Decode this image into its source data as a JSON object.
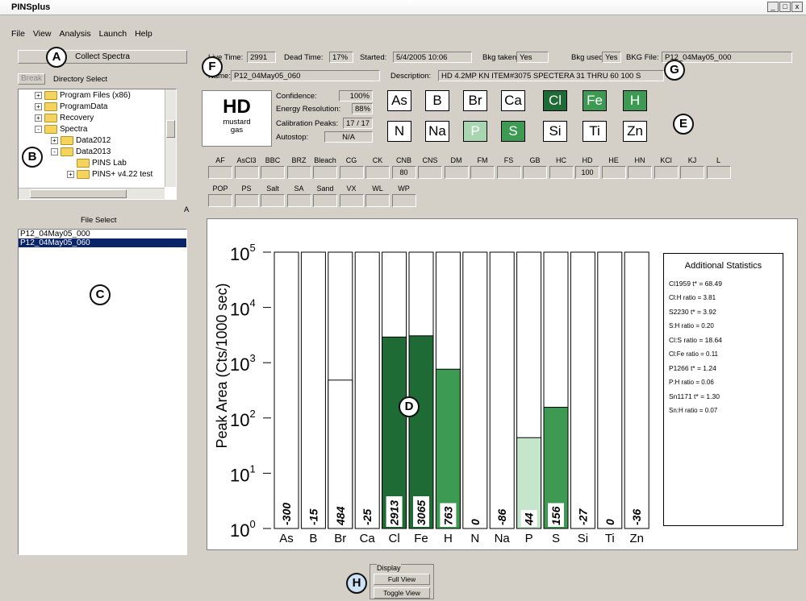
{
  "app": {
    "title": "PINSplus",
    "minimize": "_",
    "maximize": "□",
    "close": "x"
  },
  "menu": [
    "File",
    "View",
    "Analysis",
    "Launch",
    "Help"
  ],
  "left": {
    "collect_spectra": "Collect Spectra",
    "break_button": "Break",
    "directory_select": "Directory Select",
    "tree": [
      {
        "label": "Program Files (x86)",
        "expander": "+"
      },
      {
        "label": "ProgramData",
        "expander": "+"
      },
      {
        "label": "Recovery",
        "expander": "+"
      },
      {
        "label": "Spectra",
        "expander": "-"
      },
      {
        "label": "Data2012",
        "expander": "+"
      },
      {
        "label": "Data2013",
        "expander": "-"
      },
      {
        "label": "PINS Lab",
        "expander": ""
      },
      {
        "label": "PINS+ v4.22 test",
        "expander": "+"
      }
    ],
    "file_select": "File Select",
    "files": [
      "P12_04May05_000",
      "P12_04May05_060"
    ],
    "side_letter": "A"
  },
  "info": {
    "live_time_label": "Live Time:",
    "live_time": "2991",
    "dead_time_label": "Dead Time:",
    "dead_time": "17%",
    "started_label": "Started:",
    "started": "5/4/2005 10:06",
    "bkg_taken_label": "Bkg taken:",
    "bkg_taken": "Yes",
    "bkg_used_label": "Bkg used:",
    "bkg_used": "Yes",
    "bkg_file_label": "BKG File:",
    "bkg_file": "P12_04May05_000",
    "name_label": "Name:",
    "name": "P12_04May05_060",
    "description_label": "Description:",
    "description": "HD 4.2MP KN ITEM#3075 SPECTERA 31 THRU 60 100 S"
  },
  "result": {
    "agent": "HD",
    "agent_name_1": "mustard",
    "agent_name_2": "gas",
    "confidence_label": "Confidence:",
    "confidence": "100%",
    "energy_res_label": "Energy Resolution:",
    "energy_res": "88%",
    "calib_label": "Calibration Peaks:",
    "calib": "17 / 17",
    "autostop_label": "Autostop:",
    "autostop": "N/A"
  },
  "elements_row1": [
    {
      "sym": "As",
      "state": "off"
    },
    {
      "sym": "B",
      "state": "off"
    },
    {
      "sym": "Br",
      "state": "off"
    },
    {
      "sym": "Ca",
      "state": "off"
    },
    {
      "sym": "Cl",
      "state": "dark"
    },
    {
      "sym": "Fe",
      "state": "mid"
    },
    {
      "sym": "H",
      "state": "mid"
    }
  ],
  "elements_row2": [
    {
      "sym": "N",
      "state": "off"
    },
    {
      "sym": "Na",
      "state": "off"
    },
    {
      "sym": "P",
      "state": "light"
    },
    {
      "sym": "S",
      "state": "mid"
    },
    {
      "sym": "Si",
      "state": "off"
    },
    {
      "sym": "Ti",
      "state": "off"
    },
    {
      "sym": "Zn",
      "state": "off"
    }
  ],
  "compounds_row1": [
    {
      "label": "AF",
      "value": ""
    },
    {
      "label": "AsCl3",
      "value": ""
    },
    {
      "label": "BBC",
      "value": ""
    },
    {
      "label": "BRZ",
      "value": ""
    },
    {
      "label": "Bleach",
      "value": ""
    },
    {
      "label": "CG",
      "value": ""
    },
    {
      "label": "CK",
      "value": ""
    },
    {
      "label": "CNB",
      "value": "80"
    },
    {
      "label": "CNS",
      "value": ""
    },
    {
      "label": "DM",
      "value": ""
    },
    {
      "label": "FM",
      "value": ""
    },
    {
      "label": "FS",
      "value": ""
    },
    {
      "label": "GB",
      "value": ""
    },
    {
      "label": "HC",
      "value": ""
    },
    {
      "label": "HD",
      "value": "100"
    },
    {
      "label": "HE",
      "value": ""
    },
    {
      "label": "HN",
      "value": ""
    },
    {
      "label": "KCl",
      "value": ""
    },
    {
      "label": "KJ",
      "value": ""
    },
    {
      "label": "L",
      "value": ""
    }
  ],
  "compounds_row2": [
    {
      "label": "POP",
      "value": ""
    },
    {
      "label": "PS",
      "value": ""
    },
    {
      "label": "Salt",
      "value": ""
    },
    {
      "label": "SA",
      "value": ""
    },
    {
      "label": "Sand",
      "value": ""
    },
    {
      "label": "VX",
      "value": ""
    },
    {
      "label": "WL",
      "value": ""
    },
    {
      "label": "WP",
      "value": ""
    }
  ],
  "callouts": {
    "a": "A",
    "b": "B",
    "c": "C",
    "d": "D",
    "e": "E",
    "f": "F",
    "g": "G",
    "h": "H"
  },
  "stats": {
    "title": "Additional Statistics",
    "lines": [
      "Cl1959 t* = 68.49",
      "Cl:H ratio = 3.81",
      "S2230 t* = 3.92",
      "S:H ratio = 0.20",
      "Cl:S ratio = 18.64",
      "Cl:Fe ratio = 0.11",
      "P1266 t* = 1.24",
      "P:H ratio = 0.06",
      "Sn1171 t* = 1.30",
      "Sn:H ratio = 0.07"
    ]
  },
  "display": {
    "group_label": "Display",
    "full_view": "Full View",
    "toggle_view": "Toggle View"
  },
  "chart_data": {
    "type": "bar",
    "ylabel": "Peak Area (Cts/1000 sec)",
    "yscale": "log",
    "ylim": [
      1,
      100000
    ],
    "ytick_labels": [
      {
        "base": "10",
        "exp": "0"
      },
      {
        "base": "10",
        "exp": "1"
      },
      {
        "base": "10",
        "exp": "2"
      },
      {
        "base": "10",
        "exp": "3"
      },
      {
        "base": "10",
        "exp": "4"
      },
      {
        "base": "10",
        "exp": "5"
      }
    ],
    "categories": [
      "As",
      "B",
      "Br",
      "Ca",
      "Cl",
      "Fe",
      "H",
      "N",
      "Na",
      "P",
      "S",
      "Si",
      "Ti",
      "Zn"
    ],
    "values": [
      -300,
      -15,
      484,
      -25,
      2913,
      3065,
      763,
      0,
      -86,
      44,
      156,
      -27,
      0,
      -36
    ],
    "bar_colors": [
      "#ffffff",
      "#ffffff",
      "#ffffff",
      "#ffffff",
      "#1f6b35",
      "#1f6b35",
      "#3d9a52",
      "#ffffff",
      "#ffffff",
      "#c6e6cc",
      "#3d9a52",
      "#ffffff",
      "#ffffff",
      "#ffffff"
    ],
    "value_labels": [
      "-300",
      "-15",
      "484",
      "-25",
      "2913",
      "3065",
      "763",
      "0",
      "-86",
      "44",
      "156",
      "-27",
      "0",
      "-36"
    ],
    "grid": false
  }
}
